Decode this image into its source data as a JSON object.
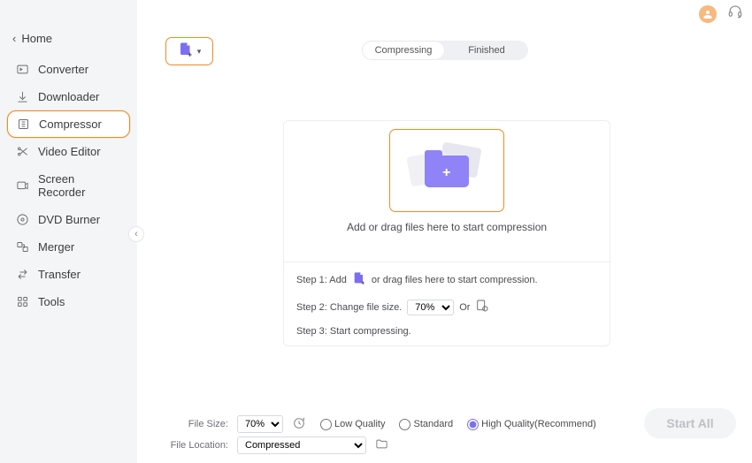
{
  "home_label": "Home",
  "sidebar": {
    "items": [
      {
        "label": "Converter"
      },
      {
        "label": "Downloader"
      },
      {
        "label": "Compressor"
      },
      {
        "label": "Video Editor"
      },
      {
        "label": "Screen Recorder"
      },
      {
        "label": "DVD Burner"
      },
      {
        "label": "Merger"
      },
      {
        "label": "Transfer"
      },
      {
        "label": "Tools"
      }
    ],
    "active_index": 2
  },
  "tabs": {
    "compressing": "Compressing",
    "finished": "Finished"
  },
  "drop_caption": "Add or drag files here to start compression",
  "steps": {
    "s1a": "Step 1: Add",
    "s1b": "or drag files here to start compression.",
    "s2a": "Step 2: Change file size.",
    "s2_size_value": "70%",
    "s2_or": "Or",
    "s3": "Step 3: Start compressing."
  },
  "footer": {
    "file_size_label": "File Size:",
    "file_size_value": "70%",
    "low": "Low Quality",
    "standard": "Standard",
    "high": "High Quality(Recommend)",
    "location_label": "File Location:",
    "location_value": "Compressed",
    "quality_selected": "high"
  },
  "start_all": "Start  All"
}
